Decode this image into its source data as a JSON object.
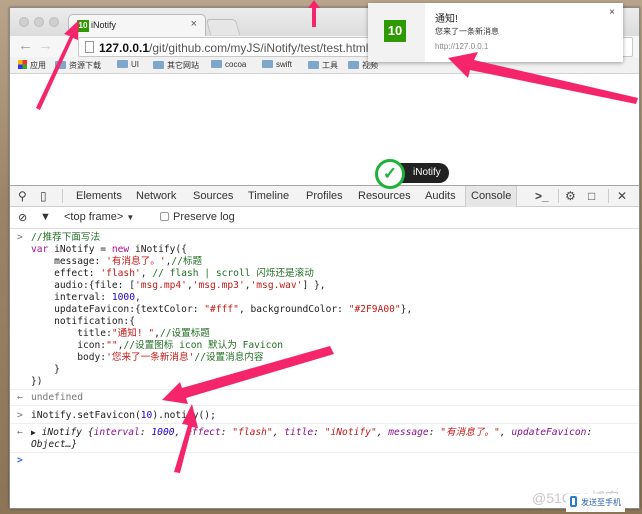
{
  "browser": {
    "tab": {
      "favicon_badge": "10",
      "title": "iNotify",
      "close": "×"
    },
    "url": {
      "host": "127.0.0.1",
      "path": "/git/github.com/myJS/iNotify/test/test.html"
    },
    "bookmarks": [
      {
        "label": "应用",
        "icon": "apps-grid-icon"
      },
      {
        "label": "资源下载",
        "icon": "folder-icon"
      },
      {
        "label": "UI",
        "icon": "folder-icon"
      },
      {
        "label": "其它网站",
        "icon": "folder-icon"
      },
      {
        "label": "cocoa",
        "icon": "folder-icon"
      },
      {
        "label": "swift",
        "icon": "folder-icon"
      },
      {
        "label": "工具",
        "icon": "folder-icon"
      },
      {
        "label": "视频",
        "icon": "folder-icon"
      }
    ]
  },
  "notification": {
    "icon_badge": "10",
    "title": "通知!",
    "body": "您来了一条新消息",
    "origin": "http://127.0.0.1",
    "close": "×",
    "badge_color": "#2F9A00"
  },
  "toast": {
    "label": "iNotify",
    "icon": "check-icon"
  },
  "devtools": {
    "tabs": [
      "Elements",
      "Network",
      "Sources",
      "Timeline",
      "Profiles",
      "Resources",
      "Audits",
      "Console"
    ],
    "active_tab": "Console",
    "console_bar": {
      "frame": "<top frame>",
      "preserve_log": "Preserve log"
    },
    "code_lines": {
      "l1": "//推荐下面写法",
      "l2a": "var",
      "l2b": " iNotify = ",
      "l2c": "new",
      "l2d": " iNotify({",
      "l3a": "    message: ",
      "l3b": "'有消息了。'",
      "l3c": ",",
      "l3d": "//标题",
      "l4a": "    effect: ",
      "l4b": "'flash'",
      "l4c": ", ",
      "l4d": "// flash | scroll 闪烁还是滚动",
      "l5a": "    audio:{file: [",
      "l5b": "'msg.mp4'",
      "l5c": ",",
      "l5d": "'msg.mp3'",
      "l5e": ",",
      "l5f": "'msg.wav'",
      "l5g": "] },",
      "l6a": "    interval: ",
      "l6b": "1000",
      "l6c": ",",
      "l7a": "    updateFavicon:{textColor: ",
      "l7b": "\"#fff\"",
      "l7c": ", backgroundColor: ",
      "l7d": "\"#2F9A00\"",
      "l7e": "},",
      "l8": "    notification:{",
      "l9a": "        title:",
      "l9b": "\"通知! \"",
      "l9c": ",",
      "l9d": "//设置标题",
      "l10a": "        icon:",
      "l10b": "\"\"",
      "l10c": ",",
      "l10d": "//设置图标 icon 默认为 Favicon",
      "l11a": "        body:",
      "l11b": "'您来了一条新消息'",
      "l11c": "//设置消息内容",
      "l12": "    }",
      "l13": "})"
    },
    "result1": "undefined",
    "command": {
      "a": "iNotify.setFavicon(",
      "b": "10",
      "c": ").notify();"
    },
    "result2": {
      "name": "iNotify",
      "open": " {",
      "k1": "interval",
      "v1": "1000",
      "k2": "effect",
      "v2": "\"flash\"",
      "k3": "title",
      "v3": "\"iNotify\"",
      "k4": "message",
      "v4": "\"有消息了。\"",
      "k5": "updateFavicon",
      "tail": "Object…}"
    }
  },
  "footer": {
    "watermark": "@51CTO博客",
    "send_to_phone": "发送至手机"
  }
}
